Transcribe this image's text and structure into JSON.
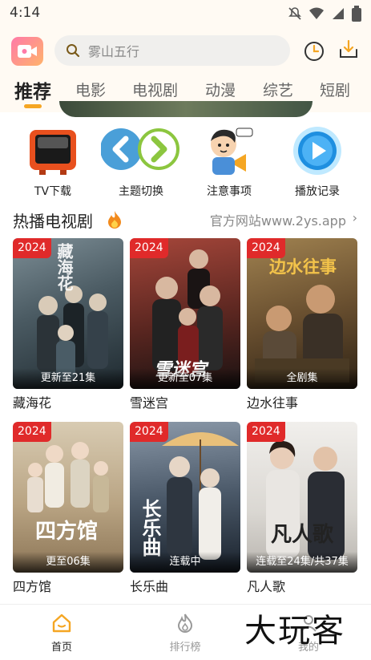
{
  "status_bar": {
    "time": "4:14",
    "icons": [
      "mute-icon",
      "wifi-icon",
      "signal-icon",
      "battery-icon"
    ]
  },
  "header": {
    "search_placeholder": "雾山五行",
    "icons": [
      "app-logo-icon",
      "search-icon",
      "history-icon",
      "download-icon"
    ]
  },
  "tabs": [
    "推荐",
    "电影",
    "电视剧",
    "动漫",
    "综艺",
    "短剧"
  ],
  "active_tab": "推荐",
  "quick_links": [
    {
      "label": "TV下载",
      "icon": "tv-icon"
    },
    {
      "label": "主题切换",
      "icon": "theme-switch-icon"
    },
    {
      "label": "注意事项",
      "icon": "notice-icon"
    },
    {
      "label": "播放记录",
      "icon": "play-record-icon"
    }
  ],
  "section": {
    "title": "热播电视剧",
    "link": "官方网站www.2ys.app",
    "arrow": "›"
  },
  "cards": [
    {
      "year": "2024",
      "episode": "更新至21集",
      "name": "藏海花",
      "poster_text": "藏海花",
      "colors": [
        "#5d6d74",
        "#2d3a40"
      ]
    },
    {
      "year": "2024",
      "episode": "更新至07集",
      "name": "雪迷宫",
      "poster_text": "雪迷宫",
      "colors": [
        "#8a3b32",
        "#2a1c1c"
      ]
    },
    {
      "year": "2024",
      "episode": "全剧集",
      "name": "边水往事",
      "poster_text": "边水往事",
      "colors": [
        "#8a6a3a",
        "#3a2c1a"
      ]
    },
    {
      "year": "2024",
      "episode": "更至06集",
      "name": "四方馆",
      "poster_text": "四方馆",
      "colors": [
        "#c9b79a",
        "#8b7455"
      ]
    },
    {
      "year": "2024",
      "episode": "连载中",
      "name": "长乐曲",
      "poster_text": "长乐曲",
      "colors": [
        "#6f7c8c",
        "#1e2733"
      ]
    },
    {
      "year": "2024",
      "episode": "连载至24集/共37集",
      "name": "凡人歌",
      "poster_text": "凡人歌",
      "colors": [
        "#e8e6e3",
        "#b9b6b1"
      ]
    }
  ],
  "bottom_nav": [
    {
      "label": "首页",
      "icon": "home-icon",
      "active": true
    },
    {
      "label": "排行榜",
      "icon": "ranking-icon",
      "active": false
    },
    {
      "label": "我的",
      "icon": "profile-icon",
      "active": false
    }
  ],
  "watermark": "大玩客",
  "colors": {
    "accent": "#f5a623",
    "badge": "#e02a2a",
    "header_bg": "#fffaf3"
  }
}
